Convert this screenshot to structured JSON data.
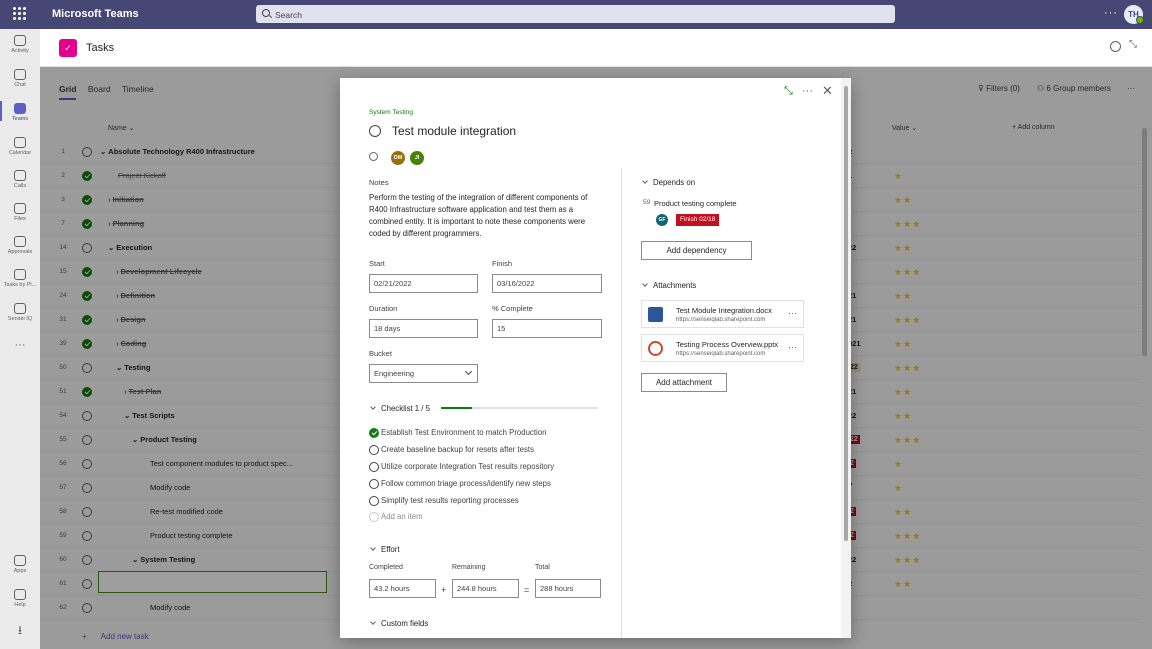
{
  "app": {
    "title": "Microsoft Teams",
    "search_placeholder": "Search",
    "user_initials": "TH",
    "more": "···"
  },
  "rail": [
    {
      "label": "Activity",
      "icon": "bell-icon"
    },
    {
      "label": "Chat",
      "icon": "chat-icon"
    },
    {
      "label": "Teams",
      "icon": "teams-icon",
      "active": true
    },
    {
      "label": "Calendar",
      "icon": "calendar-icon"
    },
    {
      "label": "Calls",
      "icon": "phone-icon"
    },
    {
      "label": "Files",
      "icon": "files-icon"
    },
    {
      "label": "Approvals",
      "icon": "approvals-icon"
    },
    {
      "label": "Tasks by Pl...",
      "icon": "tasks-icon"
    },
    {
      "label": "Sensei IQ",
      "icon": "sensei-icon"
    },
    {
      "label": "Apps",
      "icon": "apps-icon"
    },
    {
      "label": "Help",
      "icon": "help-icon"
    }
  ],
  "tab": {
    "title": "Tasks"
  },
  "grid": {
    "views": [
      "Grid",
      "Board",
      "Timeline"
    ],
    "filters": "Filters (0)",
    "group_members": "6 Group members",
    "columns": {
      "name": "Name",
      "value": "Value",
      "add_column": "Add column"
    },
    "rows": [
      {
        "num": "1",
        "name": "Absolute Technology R400 Infrastructure",
        "done": false,
        "level": 0,
        "bold": true,
        "val": "2",
        "stars": ""
      },
      {
        "num": "2",
        "name": "Project Kickoff",
        "done": true,
        "level": 1,
        "strike": true,
        "val": "1",
        "stars": "★"
      },
      {
        "num": "3",
        "name": "Initiation",
        "done": true,
        "level": 1,
        "strike": true,
        "bold": true,
        "val": "",
        "stars": "★★"
      },
      {
        "num": "7",
        "name": "Planning",
        "done": true,
        "level": 1,
        "strike": true,
        "bold": true,
        "val": "",
        "stars": "★★★"
      },
      {
        "num": "14",
        "name": "Execution",
        "done": false,
        "level": 1,
        "bold": true,
        "val": "22",
        "stars": "★★"
      },
      {
        "num": "15",
        "name": "Development Lifecycle",
        "done": true,
        "level": 2,
        "strike": true,
        "bold": true,
        "val": "",
        "stars": "★★★"
      },
      {
        "num": "24",
        "name": "Definition",
        "done": true,
        "level": 2,
        "strike": true,
        "bold": true,
        "val": "21",
        "stars": "★★"
      },
      {
        "num": "31",
        "name": "Design",
        "done": true,
        "level": 2,
        "strike": true,
        "bold": true,
        "val": "21",
        "stars": "★★★"
      },
      {
        "num": "39",
        "name": "Coding",
        "done": true,
        "level": 2,
        "strike": true,
        "bold": true,
        "val": "021",
        "stars": "★★"
      },
      {
        "num": "50",
        "name": "Testing",
        "done": false,
        "level": 2,
        "bold": true,
        "val": "22",
        "valstyle": "amber",
        "stars": "★★★"
      },
      {
        "num": "51",
        "name": "Test Plan",
        "done": true,
        "level": 3,
        "strike": true,
        "bold": true,
        "val": "21",
        "stars": "★★"
      },
      {
        "num": "54",
        "name": "Test Scripts",
        "done": false,
        "level": 3,
        "bold": true,
        "val": "22",
        "stars": "★★"
      },
      {
        "num": "55",
        "name": "Product Testing",
        "done": false,
        "level": 4,
        "bold": true,
        "val": "22",
        "valstyle": "red",
        "stars": "★★★"
      },
      {
        "num": "56",
        "name": "Test component modules to product spec...",
        "done": false,
        "level": 5,
        "val": "2",
        "valstyle": "red",
        "stars": "★"
      },
      {
        "num": "57",
        "name": "Modify code",
        "done": false,
        "level": 5,
        "val": " ",
        "valstyle": "red",
        "stars": "★"
      },
      {
        "num": "58",
        "name": "Re-test modified code",
        "done": false,
        "level": 5,
        "val": "2",
        "valstyle": "red",
        "stars": "★★"
      },
      {
        "num": "59",
        "name": "Product testing complete",
        "done": false,
        "level": 5,
        "val": "2",
        "valstyle": "red",
        "stars": "★★★"
      },
      {
        "num": "60",
        "name": "System Testing",
        "done": false,
        "level": 4,
        "bold": true,
        "val": "22",
        "stars": "★★★"
      },
      {
        "num": "61",
        "name": "Test module integration",
        "done": false,
        "level": 5,
        "val": "2",
        "stars": "★★"
      },
      {
        "num": "62",
        "name": "Modify code",
        "done": false,
        "level": 5,
        "val": "",
        "stars": ""
      }
    ],
    "add_task": "Add new task"
  },
  "modal": {
    "bucket_label": "System Testing",
    "title": "Test module integration",
    "assignees": [
      {
        "initials": "DM",
        "color": "#986f0b"
      },
      {
        "initials": "JI",
        "color": "#498205"
      }
    ],
    "notes_label": "Notes",
    "notes": "Perform the testing of the integration of different components of R400 Infrastructure software application and test them as a combined entity. It is important to note these components were coded by different programmers.",
    "start_label": "Start",
    "start": "02/21/2022",
    "finish_label": "Finish",
    "finish": "03/16/2022",
    "duration_label": "Duration",
    "duration": "18 days",
    "complete_label": "% Complete",
    "complete": "15",
    "bucket_field_label": "Bucket",
    "bucket": "Engineering",
    "checklist_label": "Checklist 1 / 5",
    "checklist_progress": 0.2,
    "checklist": [
      {
        "text": "Establish Test Environment to match Production",
        "done": true
      },
      {
        "text": "Create baseline backup for resets after tests",
        "done": false
      },
      {
        "text": "Utilize corporate Integration Test results repository",
        "done": false
      },
      {
        "text": "Follow common triage process/identify new steps",
        "done": false
      },
      {
        "text": "Simplify test results reporting processes",
        "done": false
      }
    ],
    "add_item": "Add an item",
    "effort_label": "Effort",
    "completed_label": "Completed",
    "completed": "43.2 hours",
    "remaining_label": "Remaining",
    "remaining": "244.8 hours",
    "total_label": "Total",
    "total": "288 hours",
    "plus": "+",
    "equals": "=",
    "custom_fields_label": "Custom fields",
    "depends_label": "Depends on",
    "dep_num": "59",
    "dep_name": "Product testing complete",
    "dep_initials": "GF",
    "dep_badge": "Finish 02/18",
    "add_dependency": "Add dependency",
    "attachments_label": "Attachments",
    "attachments": [
      {
        "name": "Test Module Integration.docx",
        "url": "https://senseiqlab.sharepoint.com",
        "type": "word"
      },
      {
        "name": "Testing Process Overview.pptx",
        "url": "https://senseiqlab.sharepoint.com",
        "type": "ppt"
      }
    ],
    "add_attachment": "Add attachment"
  }
}
